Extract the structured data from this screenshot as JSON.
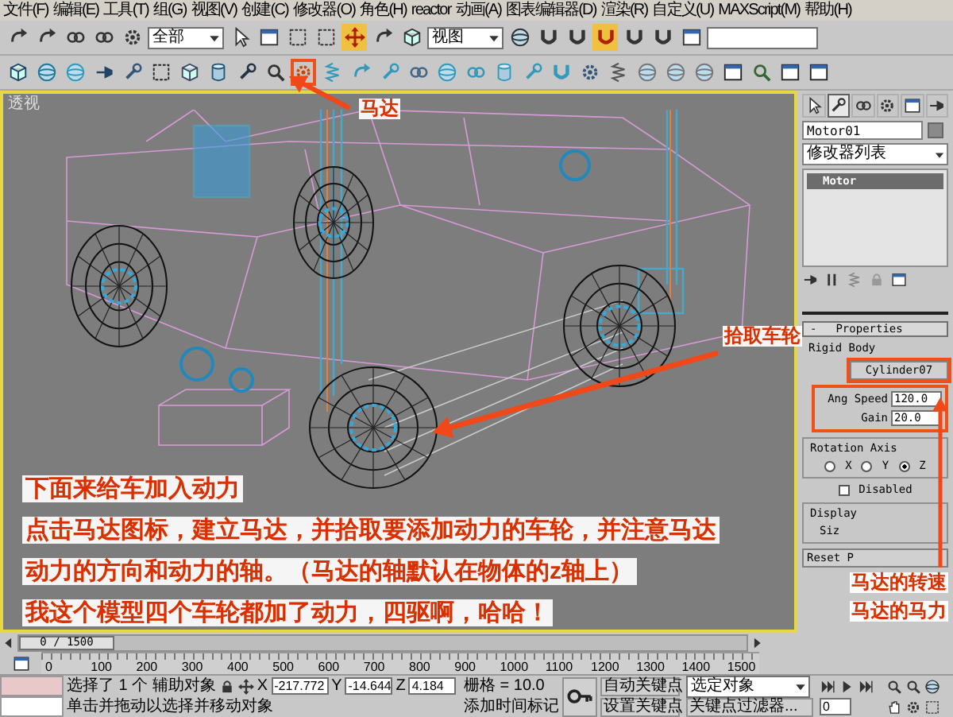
{
  "menu_bar": [
    "文件(F)",
    "编辑(E)",
    "工具(T)",
    "组(G)",
    "视图(V)",
    "创建(C)",
    "修改器(O)",
    "角色(H)",
    "reactor",
    "动画(A)",
    "图表编辑器(D)",
    "渲染(R)",
    "自定义(U)",
    "MAXScript(M)",
    "帮助(H)"
  ],
  "main_toolbar": [
    {
      "kind": "button",
      "active": false
    },
    {
      "kind": "button",
      "active": false
    },
    {
      "kind": "button",
      "active": false
    },
    {
      "kind": "button",
      "active": false
    },
    {
      "kind": "button",
      "active": false
    },
    {
      "kind": "dropdown",
      "value": "全部"
    },
    {
      "kind": "button",
      "active": false
    },
    {
      "kind": "button",
      "active": false
    },
    {
      "kind": "button",
      "active": false
    },
    {
      "kind": "button",
      "active": false
    },
    {
      "kind": "button",
      "active": true
    },
    {
      "kind": "button",
      "active": false
    },
    {
      "kind": "button",
      "active": false
    },
    {
      "kind": "dropdown",
      "value": "视图"
    },
    {
      "kind": "button",
      "active": false
    },
    {
      "kind": "button",
      "active": false
    },
    {
      "kind": "button",
      "active": false
    },
    {
      "kind": "button",
      "active": true
    },
    {
      "kind": "button",
      "active": false
    },
    {
      "kind": "button",
      "active": false
    },
    {
      "kind": "button",
      "active": false
    },
    {
      "kind": "field"
    }
  ],
  "reactor_toolbar": [
    {
      "highlighted": false
    },
    {
      "highlighted": false
    },
    {
      "highlighted": false
    },
    {
      "highlighted": false
    },
    {
      "highlighted": false
    },
    {
      "highlighted": false
    },
    {
      "highlighted": false
    },
    {
      "highlighted": false
    },
    {
      "highlighted": false
    },
    {
      "highlighted": false
    },
    {
      "highlighted": true
    },
    {
      "highlighted": false
    },
    {
      "highlighted": false
    },
    {
      "highlighted": false
    },
    {
      "highlighted": false
    },
    {
      "highlighted": false
    },
    {
      "highlighted": false
    },
    {
      "highlighted": false
    },
    {
      "highlighted": false
    },
    {
      "highlighted": false
    },
    {
      "highlighted": false
    },
    {
      "highlighted": false
    },
    {
      "highlighted": false
    },
    {
      "highlighted": false
    },
    {
      "highlighted": false
    },
    {
      "highlighted": false
    },
    {
      "highlighted": false
    },
    {
      "highlighted": false
    },
    {
      "highlighted": false
    }
  ],
  "viewport": {
    "label": "透视",
    "notes": [
      "下面来给车加入动力",
      "点击马达图标，建立马达，并拾取要添加动力的车轮，并注意马达",
      "动力的方向和动力的轴。（马达的轴默认在物体的z轴上）",
      "我这个模型四个车轮都加了动力，四驱啊，哈哈！"
    ]
  },
  "annotations": [
    {
      "kind": "label",
      "text": "马达"
    },
    {
      "kind": "label",
      "text": "拾取车轮"
    },
    {
      "kind": "label",
      "text": "马达的转速"
    },
    {
      "kind": "label",
      "text": "马达的马力"
    }
  ],
  "command_panel": {
    "tabs": [
      {
        "selected": false
      },
      {
        "selected": true
      },
      {
        "selected": false
      },
      {
        "selected": false
      },
      {
        "selected": false
      },
      {
        "selected": false
      }
    ],
    "object_name": "Motor01",
    "modifier_list": "修改器列表",
    "stack": [
      {
        "label": "Motor",
        "selected": true
      }
    ],
    "properties": {
      "toggle": "-",
      "title": "Properties",
      "rigid_body_label": "Rigid Body",
      "rigid_body": "Cylinder07",
      "rigid_body_highlighted": true,
      "spinners_highlighted": true,
      "spinners": [
        {
          "label": "Ang Speed",
          "value": "120.0"
        },
        {
          "label": "Gain",
          "value": "20.0"
        }
      ],
      "rotation_axis": {
        "title": "Rotation Axis",
        "axes": [
          {
            "label": "X",
            "selected": false
          },
          {
            "label": "Y",
            "selected": false
          },
          {
            "label": "Z",
            "selected": true
          }
        ]
      },
      "disabled": {
        "label": "Disabled",
        "checked": false
      },
      "display": {
        "title": "Display",
        "size_label": "Siz"
      },
      "reset_button": "Reset P"
    }
  },
  "time_slider": {
    "reading": "0 / 1500",
    "level": 0
  },
  "ruler_ticks": [
    "0",
    "100",
    "200",
    "300",
    "400",
    "500",
    "600",
    "700",
    "800",
    "900",
    "1000",
    "1100",
    "1200",
    "1300",
    "1400",
    "1500"
  ],
  "status": {
    "selection": "选择了 1 个 辅助对象",
    "prompt": "单击并拖动以选择并移动对象",
    "coords": [
      {
        "axis": "X",
        "value": "-217.772"
      },
      {
        "axis": "Y",
        "value": "-14.644"
      },
      {
        "axis": "Z",
        "value": "4.184"
      }
    ],
    "grid": "栅格 = 10.0",
    "time_tag": "添加时间标记",
    "auto_key": "自动关键点",
    "set_key": "设置关键点",
    "key_mode": "选定对象",
    "key_filters": "关键点过滤器...",
    "frame": "0"
  }
}
